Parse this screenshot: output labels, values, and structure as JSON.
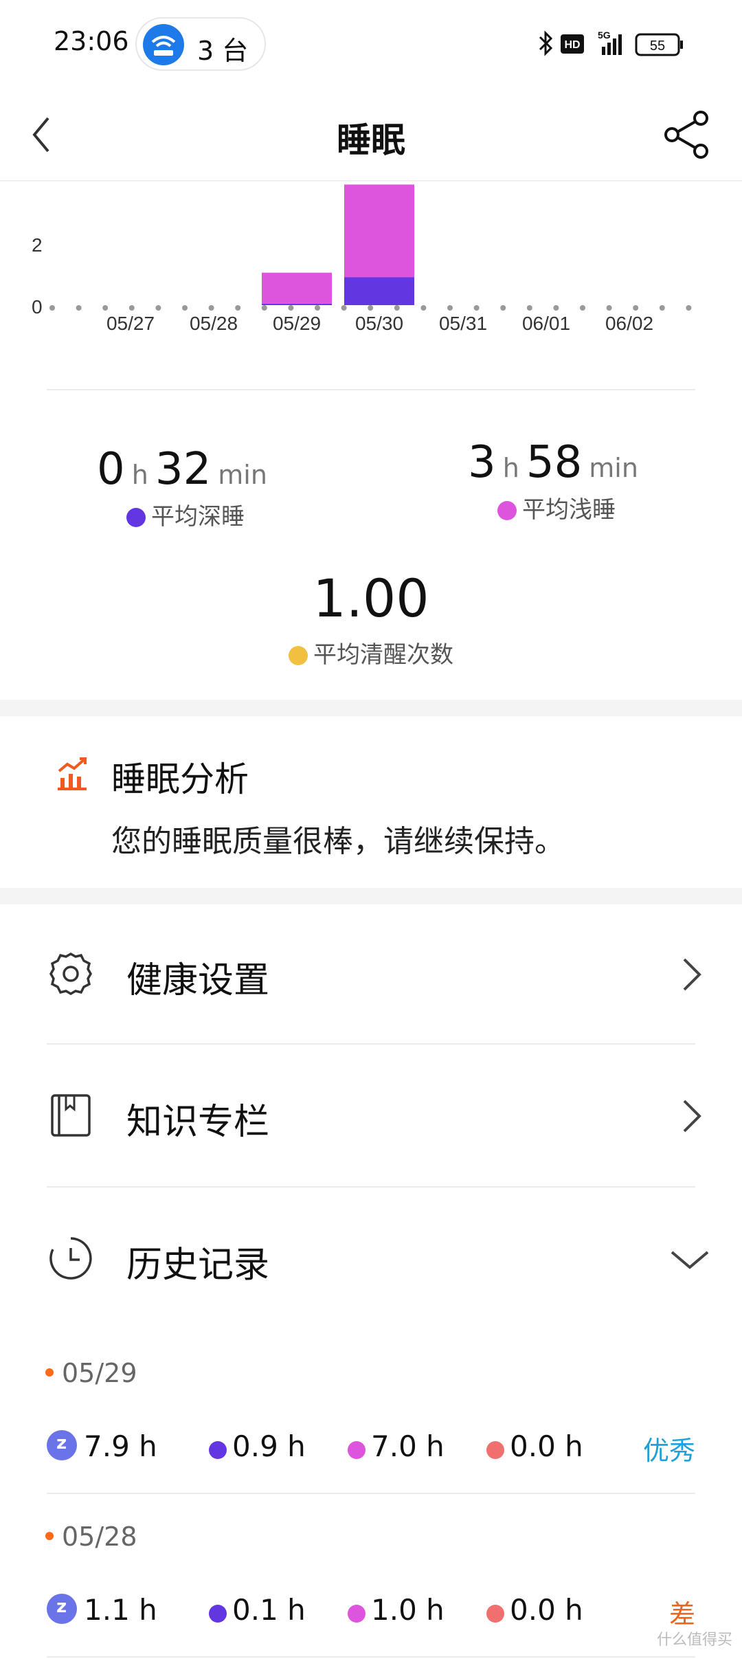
{
  "status_bar": {
    "time": "23:06",
    "devices": "3 台",
    "battery": "55",
    "network": "5G",
    "hd": "HD",
    "icons": [
      "bluetooth-icon",
      "hd-icon",
      "signal-5g-icon",
      "battery-icon"
    ]
  },
  "header": {
    "title": "睡眠",
    "back_icon": "chevron-left-icon",
    "share_icon": "share-icon"
  },
  "chart_data": {
    "type": "bar",
    "stacked": true,
    "categories": [
      "05/27",
      "05/28",
      "05/29",
      "05/30",
      "05/31",
      "06/01",
      "06/02"
    ],
    "series": [
      {
        "values": [
          0,
          0,
          0.05,
          0.9,
          0,
          0,
          0
        ],
        "color": "#6236e0"
      },
      {
        "values": [
          0,
          0,
          1.0,
          3.0,
          0,
          0,
          0
        ],
        "color": "#dd55dd"
      }
    ],
    "y_tick_labels": [
      "0",
      "2"
    ],
    "ylim": [
      0,
      4
    ],
    "grid": false
  },
  "stats": {
    "deep": {
      "hours": "0",
      "hour_unit": "h",
      "minutes": "32",
      "minute_unit": "min",
      "label": "平均深睡",
      "color": "#6236e0"
    },
    "light": {
      "hours": "3",
      "hour_unit": "h",
      "minutes": "58",
      "minute_unit": "min",
      "label": "平均浅睡",
      "color": "#dd55dd"
    },
    "awake": {
      "value": "1.00",
      "label": "平均清醒次数",
      "color": "#f2c040"
    }
  },
  "analysis": {
    "title": "睡眠分析",
    "text": "您的睡眠质量很棒，请继续保持。",
    "icon": "trend-chart-icon",
    "icon_color": "#f05a22"
  },
  "menu": {
    "health_settings": {
      "label": "健康设置",
      "icon": "gear-icon"
    },
    "knowledge": {
      "label": "知识专栏",
      "icon": "book-icon"
    },
    "history": {
      "label": "历史记录",
      "icon": "clock-history-icon"
    }
  },
  "history": [
    {
      "date": "05/29",
      "total": "7.9 h",
      "deep": "0.9 h",
      "light": "7.0 h",
      "awake": "0.0 h",
      "quality": "优秀",
      "quality_color": "#1ea0d8"
    },
    {
      "date": "05/28",
      "total": "1.1 h",
      "deep": "0.1 h",
      "light": "1.0 h",
      "awake": "0.0 h",
      "quality": "差",
      "quality_color": "#e8661e"
    }
  ],
  "watermark": "什么值得买"
}
